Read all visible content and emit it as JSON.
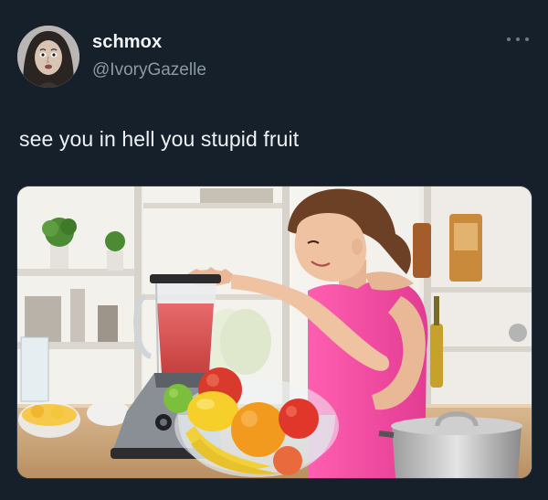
{
  "tweet": {
    "author": {
      "display_name": "schmox",
      "handle": "@IvoryGazelle",
      "avatar_icon": "profile-avatar"
    },
    "more_icon": "more-options-icon",
    "text": "see you in hell you stupid fruit",
    "media": {
      "type": "photo"
    }
  },
  "colors": {
    "background": "#15202b",
    "name": "#f2f4f6",
    "handle": "#8b98a5",
    "text": "#eef1f4"
  }
}
